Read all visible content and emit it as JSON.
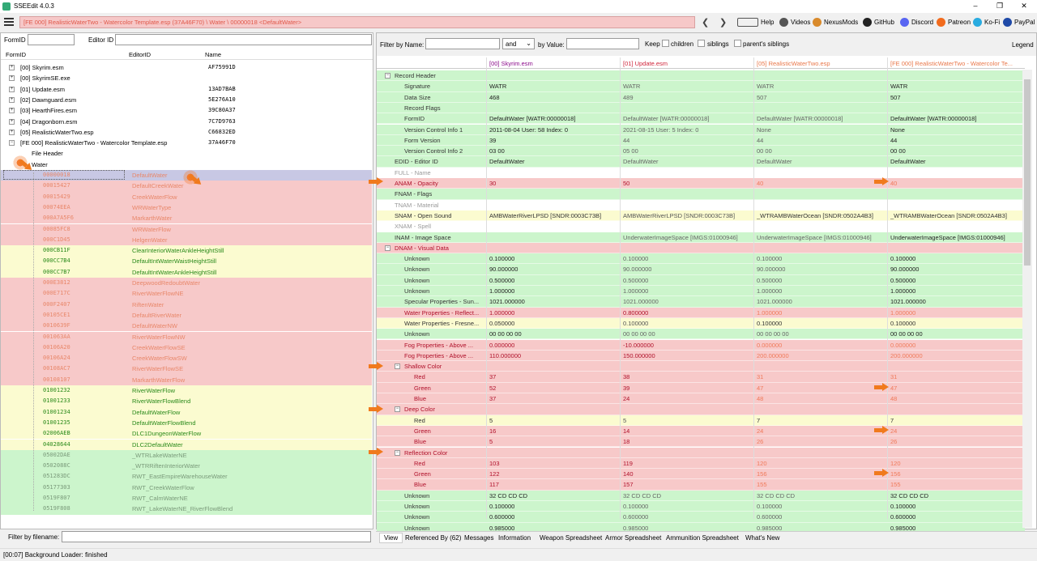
{
  "window": {
    "title": "SSEEdit 4.0.3"
  },
  "toolbar": {
    "path": "[FE 000] RealisticWaterTwo - Watercolor Template.esp (37A46F70) \\ Water \\ 00000018 <DefaultWater>",
    "links": [
      "Help",
      "Videos",
      "NexusMods",
      "GitHub",
      "Discord",
      "Patreon",
      "Ko-Fi",
      "PayPal"
    ]
  },
  "left": {
    "formid_label": "FormID",
    "editorid_label": "Editor ID",
    "headers": [
      "FormID",
      "EditorID",
      "Name"
    ],
    "files": [
      [
        "[00] Skyrim.esm",
        "AF75991D"
      ],
      [
        "[00] SkyrimSE.exe",
        ""
      ],
      [
        "[01] Update.esm",
        "13AD7BAB"
      ],
      [
        "[02] Dawnguard.esm",
        "5E276A10"
      ],
      [
        "[03] HearthFires.esm",
        "39C80A37"
      ],
      [
        "[04] Dragonborn.esm",
        "7C7D9763"
      ],
      [
        "[05] RealisticWaterTwo.esp",
        "C66832ED"
      ],
      [
        "[FE 000] RealisticWaterTwo - Watercolor Template.esp",
        "37A46F70"
      ]
    ],
    "file_header": "File Header",
    "group": "Water",
    "records": [
      [
        "00000018",
        "DefaultWater",
        "sel"
      ],
      [
        "00015427",
        "DefaultCreekWater",
        "r"
      ],
      [
        "00015429",
        "CreekWaterFlow",
        "r"
      ],
      [
        "00074EEA",
        "WRWaterType",
        "r"
      ],
      [
        "000A7A5F6",
        "MarkarthWater",
        "r"
      ],
      [
        "00085FC8",
        "WRWaterFlow",
        "r"
      ],
      [
        "000C1D45",
        "HelgenWater",
        "r"
      ],
      [
        "000CB11F",
        "ClearInteriorWaterAnkleHeightStill",
        "y"
      ],
      [
        "000CC7B4",
        "DefaultIntWaterWaistHeightStill",
        "y"
      ],
      [
        "000CC7B7",
        "DefaultIntWaterAnkleHeightStill",
        "y"
      ],
      [
        "000E3812",
        "DeepwoodRedoubtWater",
        "r"
      ],
      [
        "000E717C",
        "RiverWaterFlowNE",
        "r"
      ],
      [
        "000F2407",
        "RiftenWater",
        "r"
      ],
      [
        "00105CE1",
        "DefaultRiverWater",
        "r"
      ],
      [
        "0010639F",
        "DefaultWaterNW",
        "r"
      ],
      [
        "001063AA",
        "RiverWaterFlowNW",
        "r"
      ],
      [
        "00106A20",
        "CreekWaterFlowSE",
        "r"
      ],
      [
        "00106A24",
        "CreekWaterFlowSW",
        "r"
      ],
      [
        "00108AC7",
        "RiverWaterFlowSE",
        "r"
      ],
      [
        "00108107",
        "MarkarthWaterFlow",
        "r"
      ],
      [
        "01001232",
        "RiverWaterFlow",
        "y"
      ],
      [
        "01001233",
        "RiverWaterFlowBlend",
        "y"
      ],
      [
        "01001234",
        "DefaultWaterFlow",
        "y"
      ],
      [
        "01001235",
        "DefaultWaterFlowBlend",
        "y"
      ],
      [
        "02006AEB",
        "DLC1DungeonWaterFlow",
        "y"
      ],
      [
        "04028644",
        "DLC2DefaultWater",
        "y"
      ],
      [
        "05002DAE",
        "_WTRLakeWaterNE",
        "g"
      ],
      [
        "0502088C",
        "_WTRRiftenInteriorWater",
        "g"
      ],
      [
        "051283DC",
        "RWT_EastEmpireWarehouseWater",
        "g"
      ],
      [
        "05177303",
        "RWT_CreekWaterFlow",
        "g"
      ],
      [
        "0519F807",
        "RWT_CalmWaterNE",
        "g"
      ],
      [
        "0519F808",
        "RWT_LakeWaterNE_RiverFlowBlend",
        "g"
      ]
    ]
  },
  "filter_bar": {
    "by_name": "Filter by Name:",
    "and": "and",
    "by_value": "by Value:",
    "keep": "Keep",
    "children": "children",
    "siblings": "siblings",
    "parents_siblings": "parent's siblings",
    "legend": "Legend"
  },
  "columns": [
    "[00] Skyrim.esm",
    "[01] Update.esm",
    "[05] RealisticWaterTwo.esp",
    "[FE 000] RealisticWaterTwo - Watercolor Te..."
  ],
  "rows": [
    [
      "Record Header",
      "",
      "",
      "",
      "",
      "g",
      0,
      true
    ],
    [
      "Signature",
      "WATR",
      "WATR",
      "WATR",
      "WATR",
      "g",
      1
    ],
    [
      "Data Size",
      "468",
      "489",
      "507",
      "507",
      "g",
      1
    ],
    [
      "Record Flags",
      "",
      "",
      "",
      "",
      "g",
      1
    ],
    [
      "FormID",
      "DefaultWater [WATR:00000018]",
      "DefaultWater [WATR:00000018]",
      "DefaultWater [WATR:00000018]",
      "DefaultWater [WATR:00000018]",
      "g",
      1
    ],
    [
      "Version Control Info 1",
      "2011-08-04 User: 58 Index: 0",
      "2021-08-15 User: 5 Index: 0",
      "None",
      "None",
      "g",
      1
    ],
    [
      "Form Version",
      "39",
      "44",
      "44",
      "44",
      "g",
      1
    ],
    [
      "Version Control Info 2",
      "03 00",
      "05 00",
      "00 00",
      "00 00",
      "g",
      1
    ],
    [
      "EDID - Editor ID",
      "DefaultWater",
      "DefaultWater",
      "DefaultWater",
      "DefaultWater",
      "g",
      0
    ],
    [
      "FULL - Name",
      "",
      "",
      "",
      "",
      "w",
      0
    ],
    [
      "ANAM - Opacity",
      "30",
      "50",
      "40",
      "40",
      "r",
      0
    ],
    [
      "FNAM - Flags",
      "",
      "",
      "",
      "",
      "g",
      0
    ],
    [
      "TNAM - Material",
      "",
      "",
      "",
      "",
      "w",
      0
    ],
    [
      "SNAM - Open Sound",
      "AMBWaterRiverLPSD [SNDR:0003C73B]",
      "AMBWaterRiverLPSD [SNDR:0003C73B]",
      "_WTRAMBWaterOcean [SNDR:0502A4B3]",
      "_WTRAMBWaterOcean [SNDR:0502A4B3]",
      "y",
      0
    ],
    [
      "XNAM - Spell",
      "",
      "",
      "",
      "",
      "w",
      0
    ],
    [
      "INAM - Image Space",
      "",
      "UnderwaterImageSpace [IMGS:01000946]",
      "UnderwaterImageSpace [IMGS:01000946]",
      "UnderwaterImageSpace [IMGS:01000946]",
      "g",
      0
    ],
    [
      "DNAM - Visual Data",
      "",
      "",
      "",
      "",
      "r",
      0,
      true
    ],
    [
      "Unknown",
      "0.100000",
      "0.100000",
      "0.100000",
      "0.100000",
      "g",
      1
    ],
    [
      "Unknown",
      "90.000000",
      "90.000000",
      "90.000000",
      "90.000000",
      "g",
      1
    ],
    [
      "Unknown",
      "0.500000",
      "0.500000",
      "0.500000",
      "0.500000",
      "g",
      1
    ],
    [
      "Unknown",
      "1.000000",
      "1.000000",
      "1.000000",
      "1.000000",
      "g",
      1
    ],
    [
      "Specular Properties - Sun...",
      "1021.000000",
      "1021.000000",
      "1021.000000",
      "1021.000000",
      "g",
      1
    ],
    [
      "Water Properties - Reflect...",
      "1.000000",
      "0.800000",
      "1.000000",
      "1.000000",
      "r",
      1
    ],
    [
      "Water Properties - Fresne...",
      "0.050000",
      "0.100000",
      "0.100000",
      "0.100000",
      "y",
      1
    ],
    [
      "Unknown",
      "00 00 00 00",
      "00 00 00 00",
      "00 00 00 00",
      "00 00 00 00",
      "g",
      1
    ],
    [
      "Fog Properties - Above ...",
      "0.000000",
      "-10.000000",
      "0.000000",
      "0.000000",
      "r",
      1
    ],
    [
      "Fog Properties - Above ...",
      "110.000000",
      "150.000000",
      "200.000000",
      "200.000000",
      "r",
      1
    ],
    [
      "Shallow Color",
      "",
      "",
      "",
      "",
      "r",
      1,
      true
    ],
    [
      "Red",
      "37",
      "38",
      "31",
      "31",
      "r",
      2
    ],
    [
      "Green",
      "52",
      "39",
      "47",
      "47",
      "r",
      2
    ],
    [
      "Blue",
      "37",
      "24",
      "48",
      "48",
      "r",
      2
    ],
    [
      "Deep Color",
      "",
      "",
      "",
      "",
      "r",
      1,
      true
    ],
    [
      "Red",
      "5",
      "5",
      "7",
      "7",
      "y",
      2
    ],
    [
      "Green",
      "16",
      "14",
      "24",
      "24",
      "r",
      2
    ],
    [
      "Blue",
      "5",
      "18",
      "26",
      "26",
      "r",
      2
    ],
    [
      "Reflection Color",
      "",
      "",
      "",
      "",
      "r",
      1,
      true
    ],
    [
      "Red",
      "103",
      "119",
      "120",
      "120",
      "r",
      2
    ],
    [
      "Green",
      "122",
      "140",
      "156",
      "156",
      "r",
      2
    ],
    [
      "Blue",
      "117",
      "157",
      "155",
      "155",
      "r",
      2
    ],
    [
      "Unknown",
      "32 CD CD CD",
      "32 CD CD CD",
      "32 CD CD CD",
      "32 CD CD CD",
      "g",
      1
    ],
    [
      "Unknown",
      "0.100000",
      "0.100000",
      "0.100000",
      "0.100000",
      "g",
      1
    ],
    [
      "Unknown",
      "0.600000",
      "0.600000",
      "0.600000",
      "0.600000",
      "g",
      1
    ],
    [
      "Unknown",
      "0.985000",
      "0.985000",
      "0.985000",
      "0.985000",
      "g",
      1
    ]
  ],
  "tabs": [
    "View",
    "Referenced By (62)",
    "Messages",
    "Information",
    "Weapon Spreadsheet",
    "Armor Spreadsheet",
    "Ammunition Spreadsheet",
    "What's New"
  ],
  "filename_label": "Filter by filename:",
  "status": "[00:07] Background Loader: finished",
  "colors": {
    "green": "#ccf5cc",
    "red": "#f7c9c9",
    "yellow": "#fbfbd0",
    "white": "#ffffff",
    "sel": "#c8c8e4"
  }
}
